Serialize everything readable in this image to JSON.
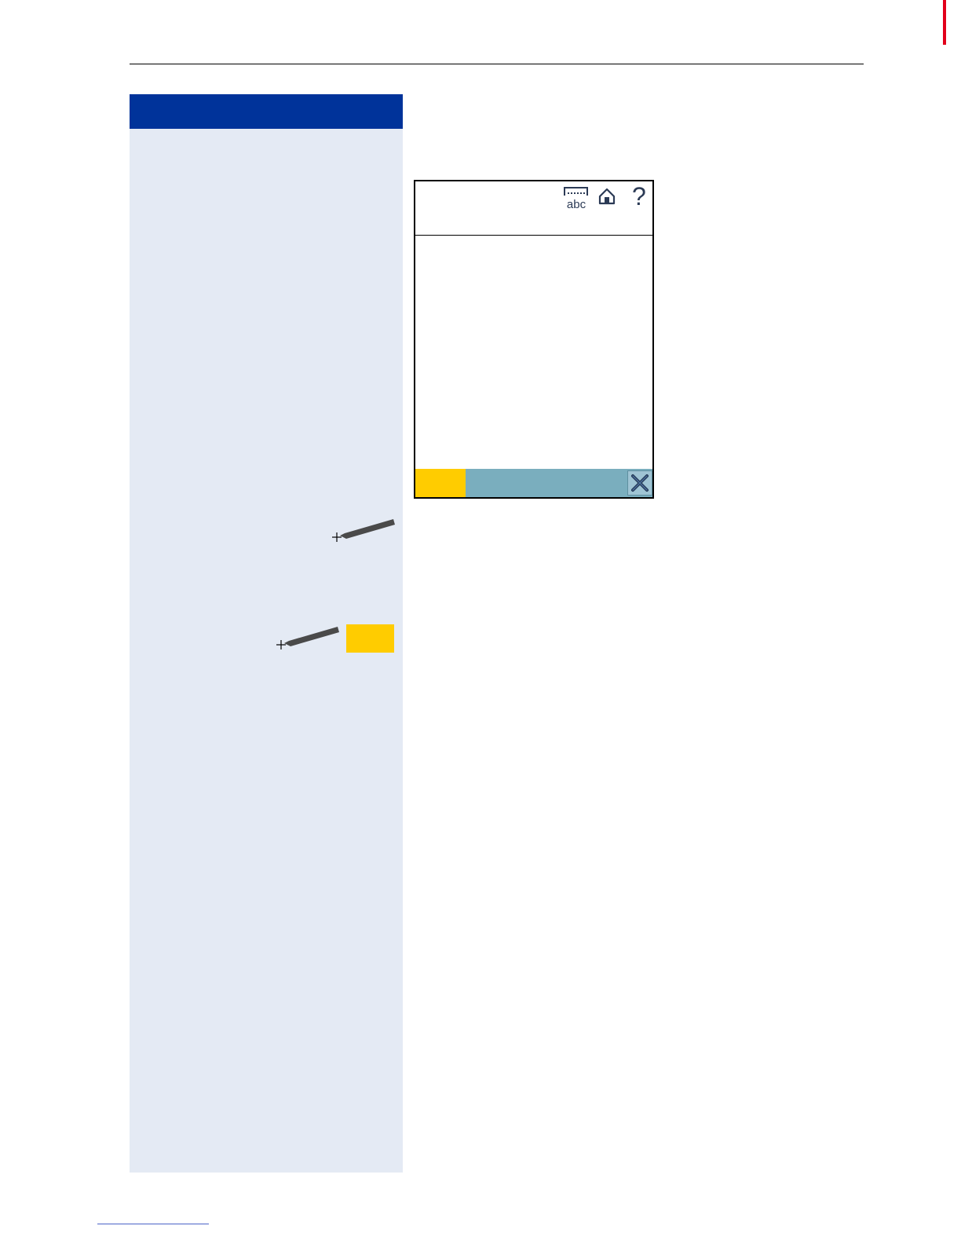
{
  "page": {
    "accent_color": "#00339a",
    "panel_color": "#e4eaf4",
    "softkey_color": "#ffcc00",
    "footer_color": "#7aaebe"
  },
  "screen": {
    "header_icons": [
      "keyboard-abc-icon",
      "home-icon",
      "help-icon"
    ],
    "keyboard_icon_text": "abc",
    "help_icon_text": "?",
    "footer_softkey_label": "",
    "close_icon": "close-icon"
  },
  "sidebar": {
    "steps": [
      {
        "icon": "stylus-icon",
        "key_label": ""
      },
      {
        "icon": "stylus-icon",
        "key_label": ""
      }
    ]
  }
}
